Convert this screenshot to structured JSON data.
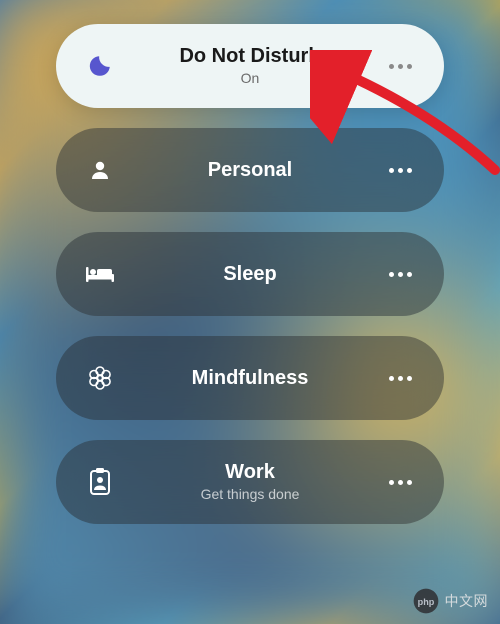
{
  "focus_modes": [
    {
      "id": "dnd",
      "title": "Do Not Disturb",
      "subtitle": "On",
      "active": true,
      "icon": "moon"
    },
    {
      "id": "personal",
      "title": "Personal",
      "subtitle": "",
      "active": false,
      "icon": "person"
    },
    {
      "id": "sleep",
      "title": "Sleep",
      "subtitle": "",
      "active": false,
      "icon": "bed"
    },
    {
      "id": "mindfulness",
      "title": "Mindfulness",
      "subtitle": "",
      "active": false,
      "icon": "flower"
    },
    {
      "id": "work",
      "title": "Work",
      "subtitle": "Get things done",
      "active": false,
      "icon": "badge"
    }
  ],
  "colors": {
    "active_bg": "#eef5f5",
    "inactive_bg": "rgba(40,45,48,0.45)",
    "moon_icon": "#5756ce",
    "inactive_icon": "#ffffff",
    "arrow": "#e3202a"
  },
  "watermark": {
    "text": "中文网",
    "prefix": "php"
  }
}
